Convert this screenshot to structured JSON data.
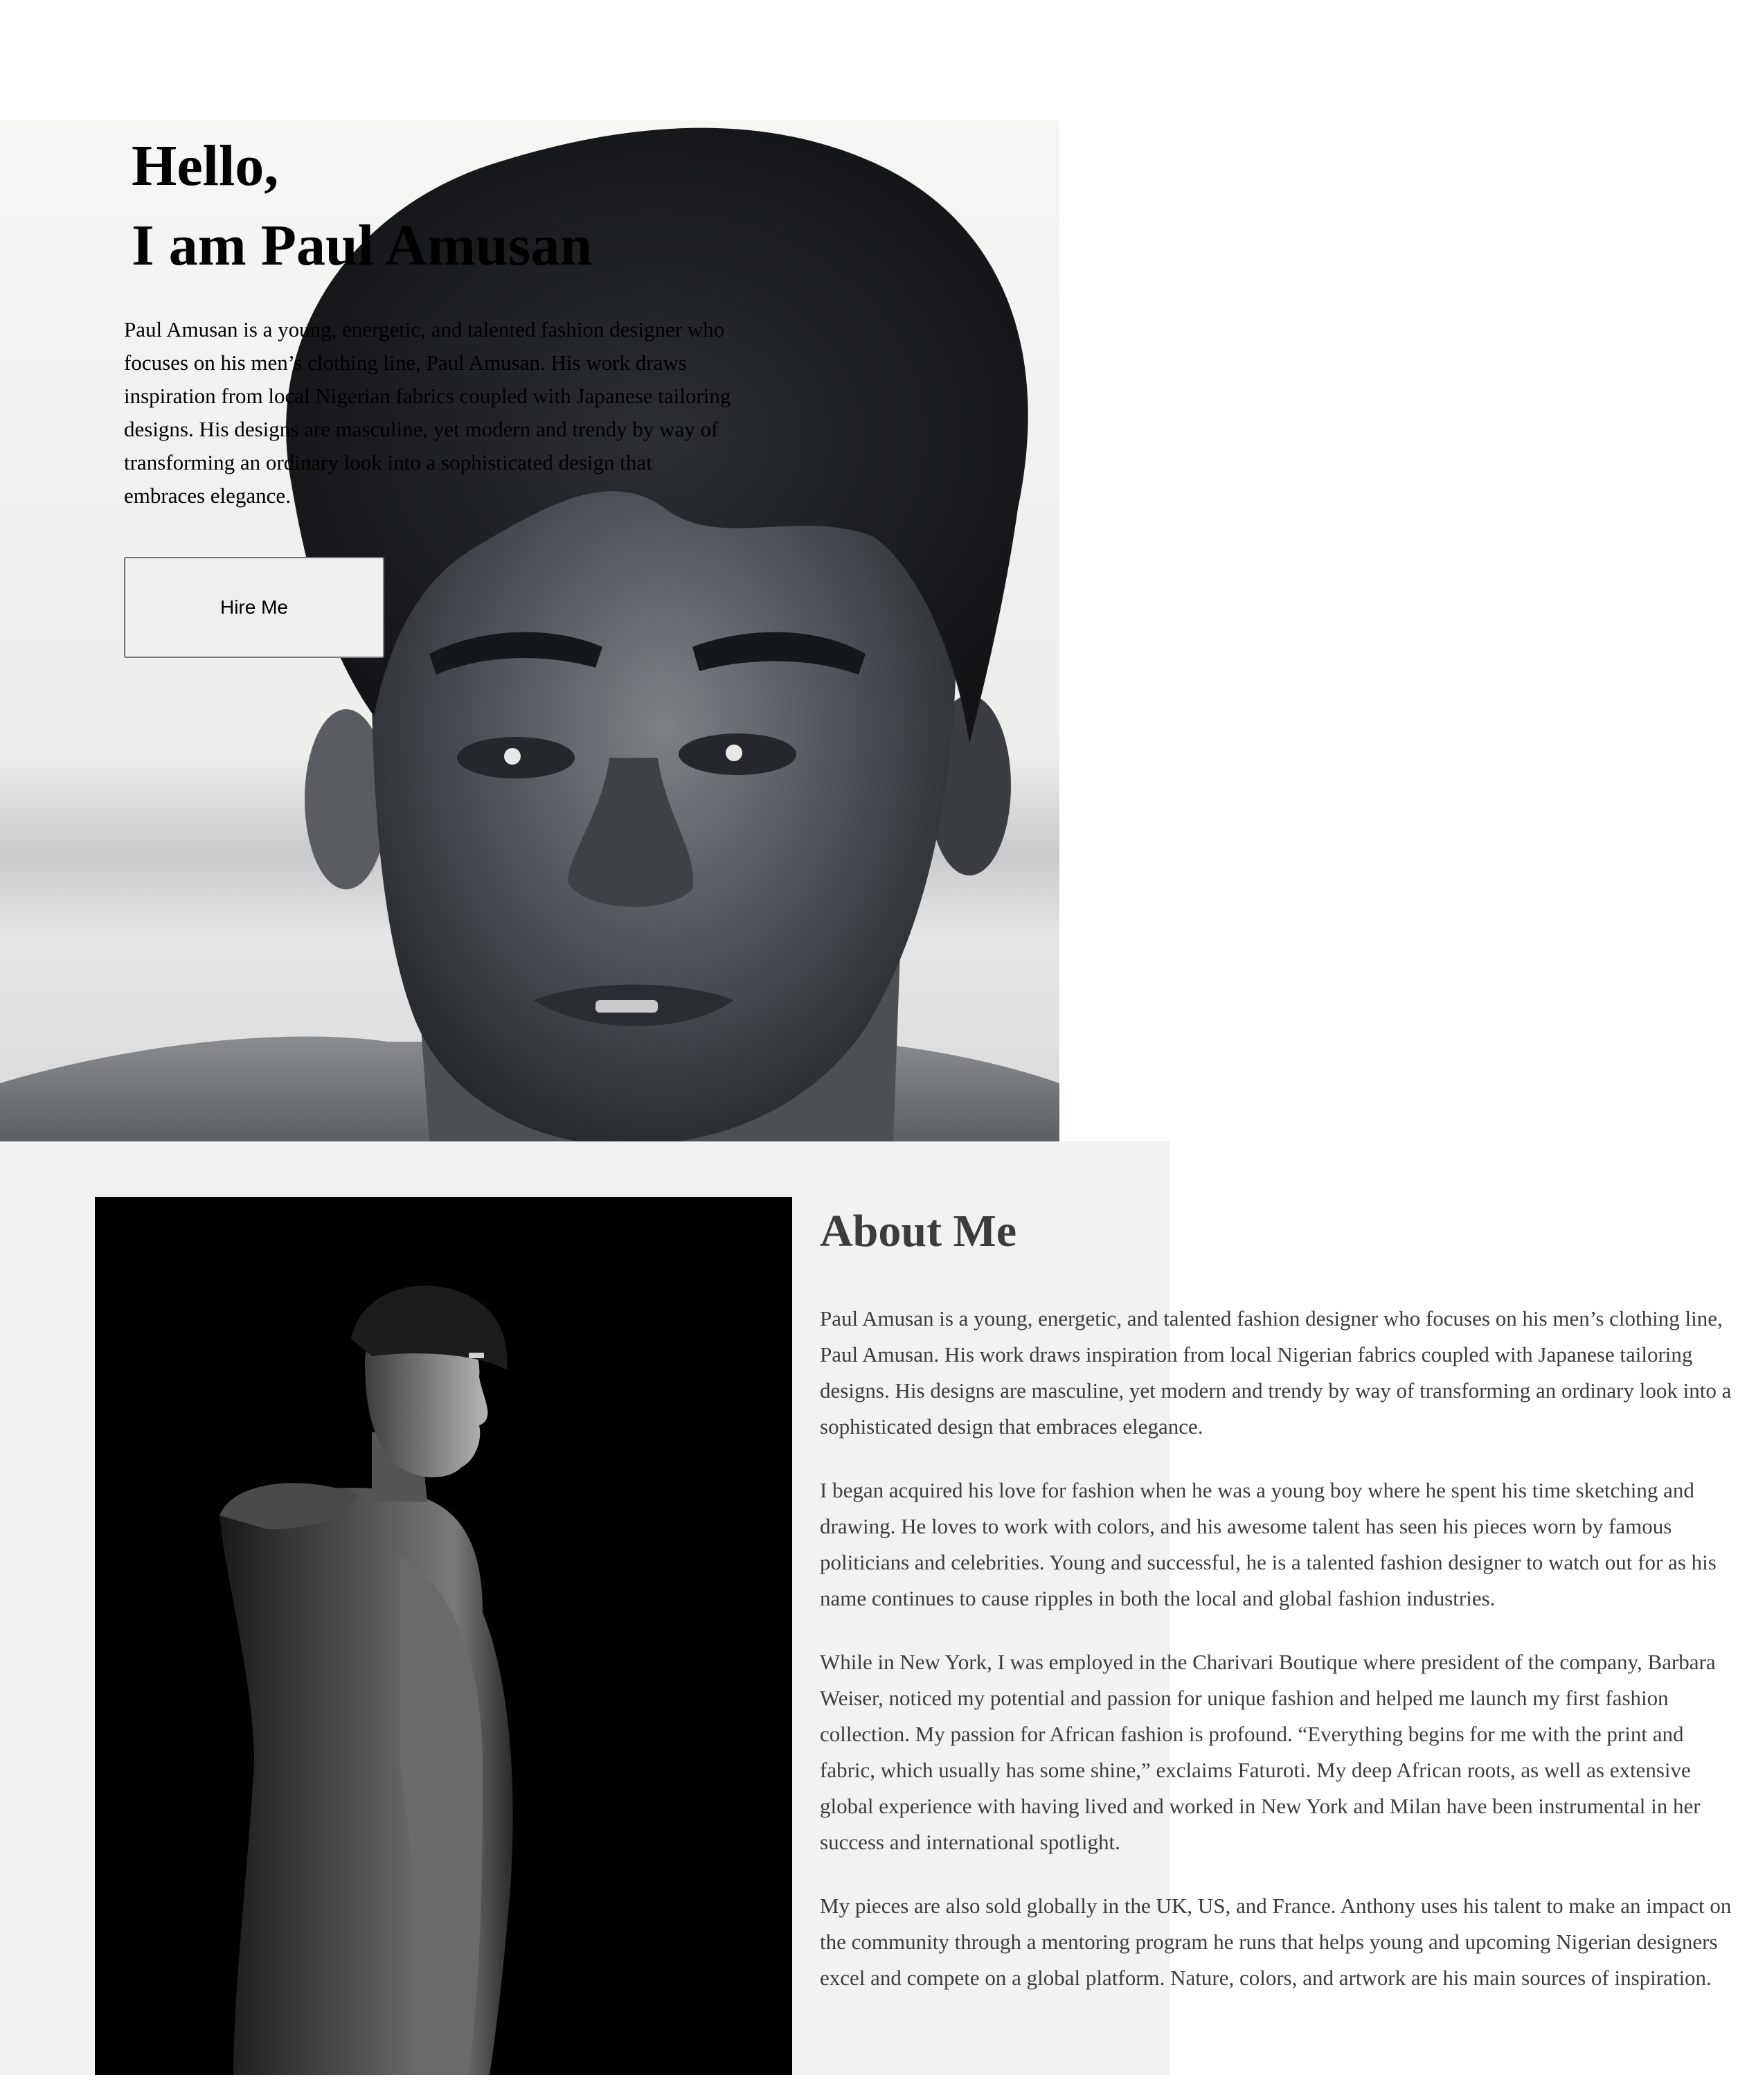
{
  "hero": {
    "greeting": "Hello,",
    "name_line": "I am Paul Amusan",
    "intro": "Paul Amusan is a young, energetic, and talented fashion designer who focuses on his men’s clothing line, Paul Amusan. His work draws inspiration from local Nigerian fabrics coupled with Japanese tailoring designs. His designs are masculine, yet modern and trendy by way of transforming an ordinary look into a sophisticated design that embraces elegance.",
    "hire_button": "Hire Me"
  },
  "about": {
    "title": "About Me",
    "paragraphs": [
      "Paul Amusan is a young, energetic, and talented fashion designer who focuses on his men’s clothing line, Paul Amusan. His work draws inspiration from local Nigerian fabrics coupled with Japanese tailoring designs. His designs are masculine, yet modern and trendy by way of transforming an ordinary look into a sophisticated design that embraces elegance.",
      "I began acquired his love for fashion when he was a young boy where he spent his time sketching and drawing. He loves to work with colors, and his awesome talent has seen his pieces worn by famous politicians and celebrities. Young and successful, he is a talented fashion designer to watch out for as his name continues to cause ripples in both the local and global fashion industries.",
      "While in New York, I was employed in the Charivari Boutique where president of the company, Barbara Weiser, noticed my potential and passion for unique fashion and helped me launch my first fashion collection. My passion for African fashion is profound. “Everything begins for me with the print and fabric, which usually has some shine,” exclaims Faturoti. My deep African roots, as well as extensive global experience with having lived and worked in New York and Milan have been instrumental in her success and international spotlight.",
      "My pieces are also sold globally in the UK, US, and France. Anthony uses his talent to make an impact on the community through a mentoring program he runs that helps young and upcoming Nigerian designers excel and compete on a global platform. Nature, colors, and artwork are his main sources of inspiration."
    ]
  },
  "colors": {
    "page_background": "#ffffff",
    "about_background": "#f2f2f2",
    "about_text": "#3c3c3c",
    "button_background": "#efefef",
    "button_border": "#767676"
  }
}
